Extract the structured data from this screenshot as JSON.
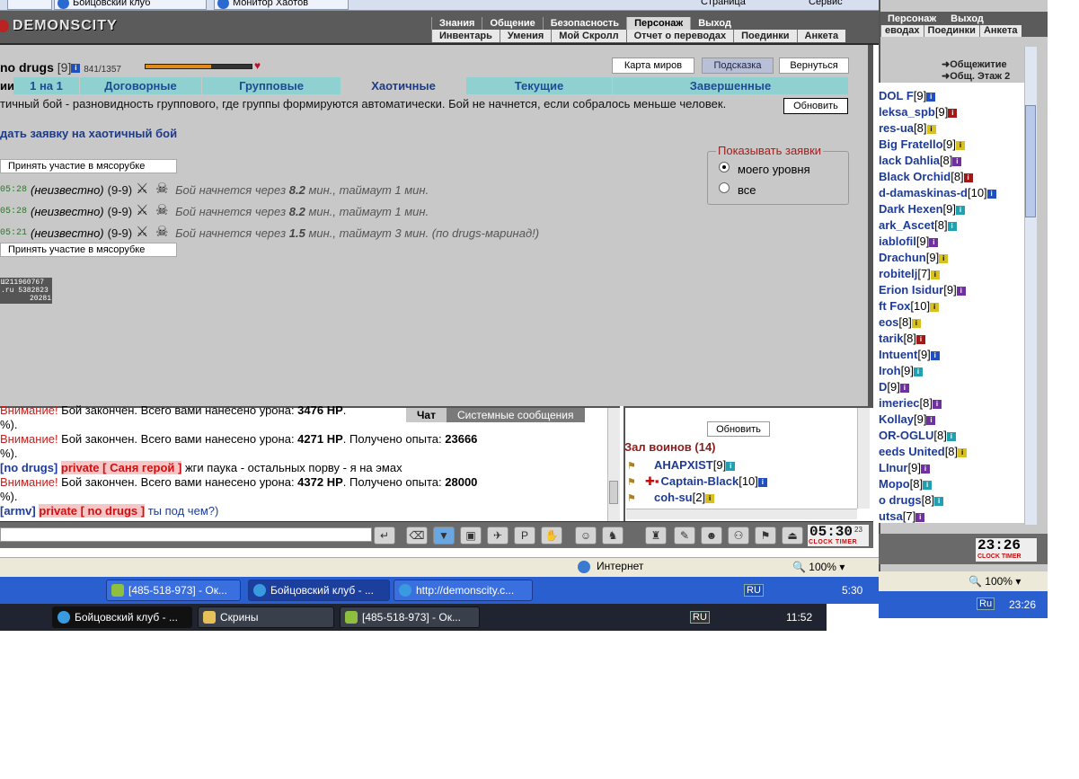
{
  "ie_tabs": [
    "Бойцовский клуб",
    "Монитор Хаотов"
  ],
  "ie_toolbar": [
    "Страница",
    "Сервис"
  ],
  "logo": "DEMONSCITY",
  "top_menu": [
    "Знания",
    "Общение",
    "Безопасность",
    "Персонаж",
    "Выход"
  ],
  "sub_menu": [
    "Инвентарь",
    "Умения",
    "Мой Скролл",
    "Отчет о переводах",
    "Поединки",
    "Анкета"
  ],
  "player": {
    "name": "no drugs",
    "level": "[9]",
    "info": "i",
    "hp": "841/1357",
    "hp_fraction": 0.62
  },
  "buttons": {
    "map": "Карта миров",
    "hint": "Подсказка",
    "back": "Вернуться",
    "refresh": "Обновить"
  },
  "tabs_prefix": "ии:",
  "tabs": [
    "1 на 1",
    "Договорные",
    "Групповые",
    "Хаотичные",
    "Текущие",
    "Завершенные"
  ],
  "description": "тичный бой - разновидность группового, где группы формируются автоматически. Бой не начнется, если собралось меньше человек.",
  "create_link": "дать заявку на хаотичный бой",
  "join_label": "Принять участие в мясорубке",
  "requests": [
    {
      "time": "05:28",
      "who": "(неизвестно)",
      "range": "(9-9)",
      "msg_pre": "Бой начнется через",
      "min": "8.2",
      "msg_post": "мин., таймаут 1 мин."
    },
    {
      "time": "05:28",
      "who": "(неизвестно)",
      "range": "(9-9)",
      "msg_pre": "Бой начнется через",
      "min": "8.2",
      "msg_post": "мин., таймаут 1 мин."
    },
    {
      "time": "05:21",
      "who": "(неизвестно)",
      "range": "(9-9)",
      "msg_pre": "Бой начнется через",
      "min": "1.5",
      "msg_post": "мин., таймаут 3 мин. (по drugs-маринад!)"
    }
  ],
  "show_filter": {
    "legend": "Показывать заявки",
    "opt1": "моего уровня",
    "opt2": "все",
    "selected": "моего уровня"
  },
  "counter": {
    "l1": "Ш211960767",
    "l2": ".ru 5382823",
    "l3": "20281"
  },
  "chat_tabs": [
    "Чат",
    "Системные сообщения"
  ],
  "chat": [
    {
      "warn": "Внимание!",
      "text": " Бой закончен. Всего вами нанесено урона: ",
      "bold": "3476 HP",
      "tail": "."
    },
    {
      "pre": "%)."
    },
    {
      "warn": "Внимание!",
      "text": " Бой закончен. Всего вами нанесено урона: ",
      "bold": "4271 HP",
      "tail": ". Получено опыта: ",
      "bold2": "23666"
    },
    {
      "pre": "%)."
    },
    {
      "nick": "[no drugs]",
      "priv": "private [ Саня герой ]",
      "tail": " жги паука - остальных порву - я на эмах"
    },
    {
      "warn": "Внимание!",
      "text": " Бой закончен. Всего вами нанесено урона: ",
      "bold": "4372 HP",
      "tail": ". Получено опыта: ",
      "bold2": "28000"
    },
    {
      "pre": "%)."
    },
    {
      "nick": "[armv]",
      "priv": "private [ no drugs ]",
      "tail": " ты под чем?)"
    }
  ],
  "online": {
    "refresh": "Обновить",
    "hall": "Зал воинов (14)",
    "rows": [
      {
        "name": "AHAPXIST",
        "lvl": "[9]"
      },
      {
        "name": "Captain-Black",
        "lvl": "[10]"
      },
      {
        "name": "coh-su",
        "lvl": "[2]"
      }
    ]
  },
  "clock": {
    "time": "05:30",
    "sec": "23",
    "label": "CLOCK TIMER"
  },
  "status": {
    "zone": "Интернет",
    "zoom": "100%"
  },
  "taskbar1": {
    "tasks": [
      "[485-518-973] - Ок...",
      "Бойцовский клуб - ...",
      "http://demonscity.c..."
    ],
    "lang": "RU",
    "time": "5:30"
  },
  "taskbar2": {
    "tasks": [
      "Бойцовский клуб - ...",
      "Скрины",
      "[485-518-973] - Ок..."
    ],
    "lang": "RU",
    "time": "11:52"
  },
  "right_panel": {
    "menu1": [
      "Персонаж",
      "Выход"
    ],
    "menu2": [
      "еводах",
      "Поединки",
      "Анкета"
    ],
    "hostel": "Общежитие",
    "hostel2": "Общ. Этаж 2",
    "list": [
      {
        "name": "DOL F",
        "lvl": "[9]"
      },
      {
        "name": "leksa_spb",
        "lvl": "[9]"
      },
      {
        "name": "res-ua",
        "lvl": "[8]"
      },
      {
        "name": "Big Fratello",
        "lvl": "[9]"
      },
      {
        "name": "lack Dahlia",
        "lvl": "[8]"
      },
      {
        "name": "Black Orchid",
        "lvl": "[8]"
      },
      {
        "name": "d-damaskinas-d",
        "lvl": "[10]"
      },
      {
        "name": "Dark Hexen",
        "lvl": "[9]"
      },
      {
        "name": "ark_Ascet",
        "lvl": "[8]"
      },
      {
        "name": "iablofil",
        "lvl": "[9]"
      },
      {
        "name": "Drachun",
        "lvl": "[9]"
      },
      {
        "name": "robitelj",
        "lvl": "[7]"
      },
      {
        "name": "Erion Isidur",
        "lvl": "[9]"
      },
      {
        "name": "ft Fox",
        "lvl": "[10]"
      },
      {
        "name": "eos",
        "lvl": "[8]"
      },
      {
        "name": "tarik",
        "lvl": "[8]"
      },
      {
        "name": "Intuent",
        "lvl": "[9]"
      },
      {
        "name": "Iroh",
        "lvl": "[9]"
      },
      {
        "name": "D",
        "lvl": "[9]"
      },
      {
        "name": "imeriec",
        "lvl": "[8]"
      },
      {
        "name": "Kollay",
        "lvl": "[9]"
      },
      {
        "name": "OR-OGLU",
        "lvl": "[8]"
      },
      {
        "name": "eeds United",
        "lvl": "[8]"
      },
      {
        "name": "LInur",
        "lvl": "[9]"
      },
      {
        "name": "Mopo",
        "lvl": "[8]"
      },
      {
        "name": "o drugs",
        "lvl": "[8]"
      },
      {
        "name": "utsa",
        "lvl": "[7]"
      }
    ],
    "clock": "23:26",
    "clock_label": "CLOCK TIMER",
    "zoom": "100%",
    "lang": "Ru",
    "time": "23:26"
  }
}
